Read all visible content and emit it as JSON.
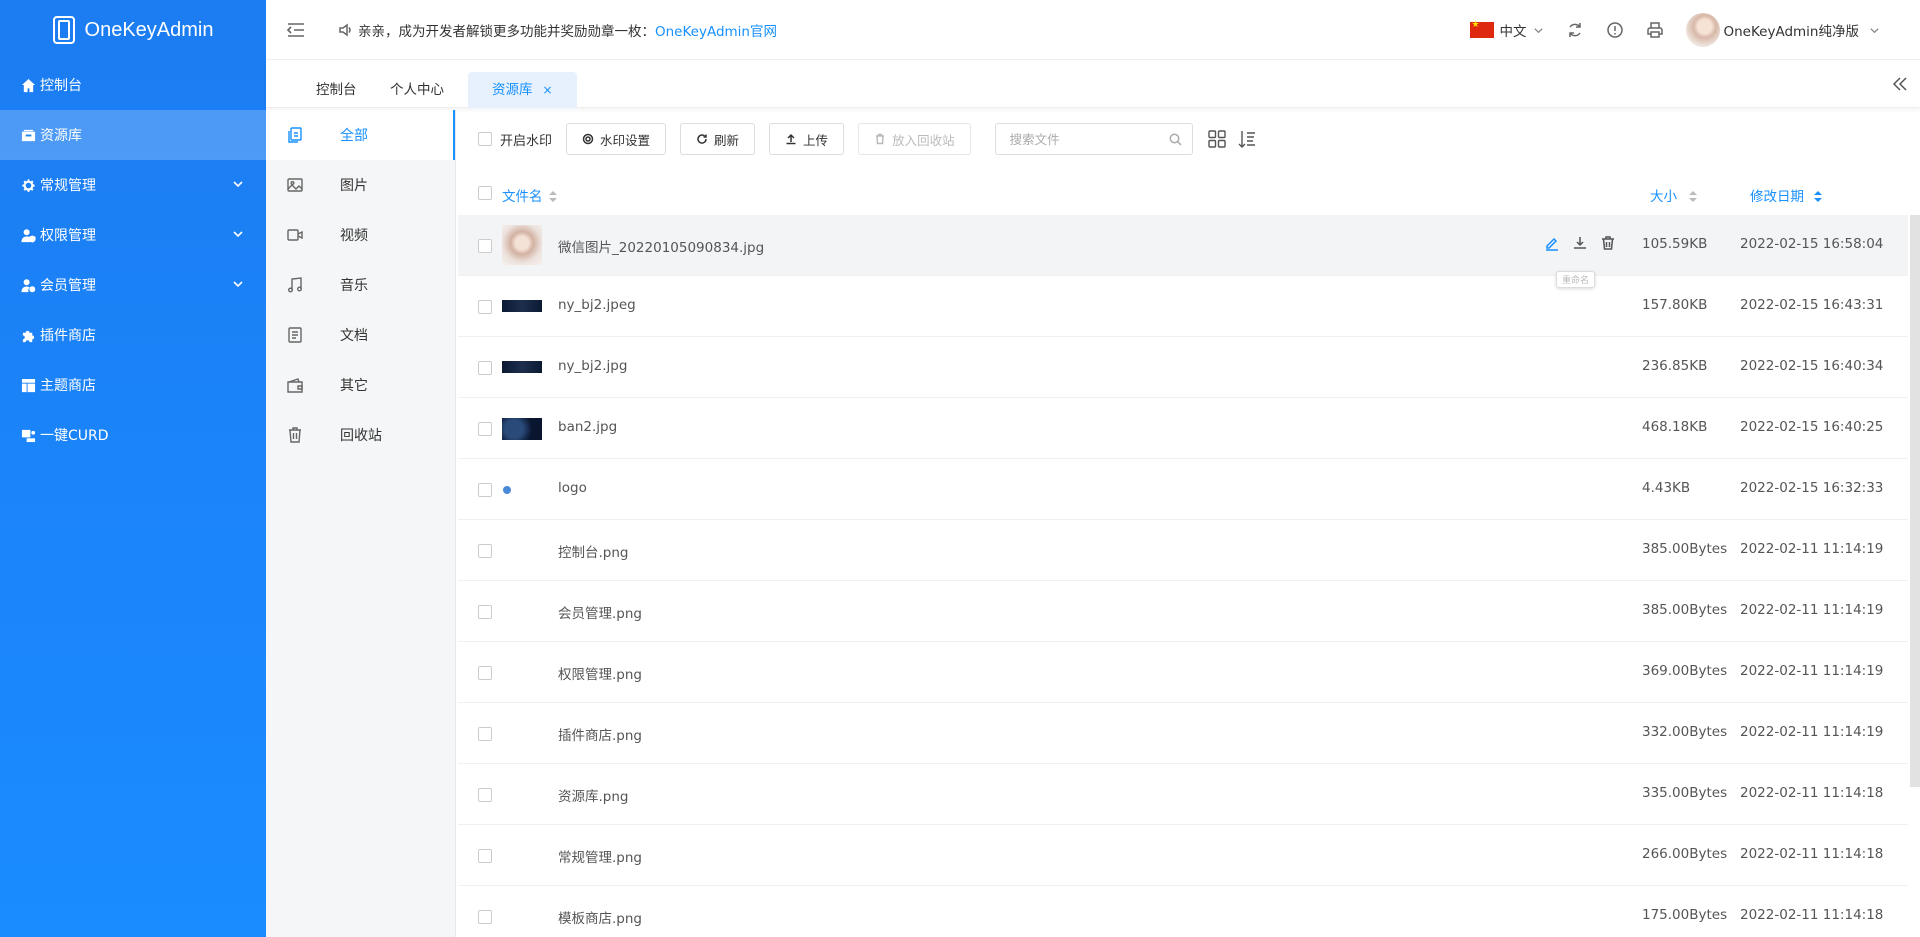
{
  "app": {
    "title": "OneKeyAdmin"
  },
  "sidebar": {
    "items": [
      {
        "label": "控制台",
        "icon": "home-icon",
        "has_children": false,
        "active": false
      },
      {
        "label": "资源库",
        "icon": "archive-icon",
        "has_children": false,
        "active": true
      },
      {
        "label": "常规管理",
        "icon": "gear-icon",
        "has_children": true,
        "active": false
      },
      {
        "label": "权限管理",
        "icon": "user-shield-icon",
        "has_children": true,
        "active": false
      },
      {
        "label": "会员管理",
        "icon": "users-icon",
        "has_children": true,
        "active": false
      },
      {
        "label": "插件商店",
        "icon": "puzzle-icon",
        "has_children": false,
        "active": false
      },
      {
        "label": "主题商店",
        "icon": "layout-icon",
        "has_children": false,
        "active": false
      },
      {
        "label": "一键CURD",
        "icon": "code-icon",
        "has_children": false,
        "active": false
      }
    ]
  },
  "header": {
    "notice_text": "亲亲，成为开发者解锁更多功能并奖励勋章一枚：",
    "notice_link": "OneKeyAdmin官网",
    "language": "中文",
    "user_name": "OneKeyAdmin纯净版"
  },
  "tabs": [
    {
      "label": "控制台",
      "active": false
    },
    {
      "label": "个人中心",
      "active": false
    },
    {
      "label": "资源库",
      "active": true,
      "close": "×"
    }
  ],
  "categories": [
    {
      "label": "全部",
      "icon": "files-icon",
      "active": true
    },
    {
      "label": "图片",
      "icon": "image-icon",
      "active": false
    },
    {
      "label": "视频",
      "icon": "video-icon",
      "active": false
    },
    {
      "label": "音乐",
      "icon": "music-icon",
      "active": false
    },
    {
      "label": "文档",
      "icon": "document-icon",
      "active": false
    },
    {
      "label": "其它",
      "icon": "wallet-icon",
      "active": false
    },
    {
      "label": "回收站",
      "icon": "trash-icon",
      "active": false
    }
  ],
  "toolbar": {
    "watermark_toggle": "开启水印",
    "watermark_settings": "水印设置",
    "refresh": "刷新",
    "upload": "上传",
    "recycle": "放入回收站",
    "search_placeholder": "搜索文件"
  },
  "table": {
    "columns": {
      "name": "文件名",
      "size": "大小",
      "date": "修改日期"
    },
    "tooltip": "重命名",
    "rows": [
      {
        "name": "微信图片_20220105090834.jpg",
        "size": "105.59KB",
        "date": "2022-02-15 16:58:04",
        "thumb": "photo"
      },
      {
        "name": "ny_bj2.jpeg",
        "size": "157.80KB",
        "date": "2022-02-15 16:43:31",
        "thumb": "dark-banner"
      },
      {
        "name": "ny_bj2.jpg",
        "size": "236.85KB",
        "date": "2022-02-15 16:40:34",
        "thumb": "dark-banner"
      },
      {
        "name": "ban2.jpg",
        "size": "468.18KB",
        "date": "2022-02-15 16:40:25",
        "thumb": "dark-square"
      },
      {
        "name": "logo",
        "size": "4.43KB",
        "date": "2022-02-15 16:32:33",
        "thumb": "dot"
      },
      {
        "name": "控制台.png",
        "size": "385.00Bytes",
        "date": "2022-02-11 11:14:19",
        "thumb": "none"
      },
      {
        "name": "会员管理.png",
        "size": "385.00Bytes",
        "date": "2022-02-11 11:14:19",
        "thumb": "none"
      },
      {
        "name": "权限管理.png",
        "size": "369.00Bytes",
        "date": "2022-02-11 11:14:19",
        "thumb": "none"
      },
      {
        "name": "插件商店.png",
        "size": "332.00Bytes",
        "date": "2022-02-11 11:14:19",
        "thumb": "none"
      },
      {
        "name": "资源库.png",
        "size": "335.00Bytes",
        "date": "2022-02-11 11:14:18",
        "thumb": "none"
      },
      {
        "name": "常规管理.png",
        "size": "266.00Bytes",
        "date": "2022-02-11 11:14:18",
        "thumb": "none"
      },
      {
        "name": "模板商店.png",
        "size": "175.00Bytes",
        "date": "2022-02-11 11:14:18",
        "thumb": "none"
      }
    ]
  },
  "colors": {
    "primary": "#1890ff",
    "sidebar": "#1a84f5"
  }
}
